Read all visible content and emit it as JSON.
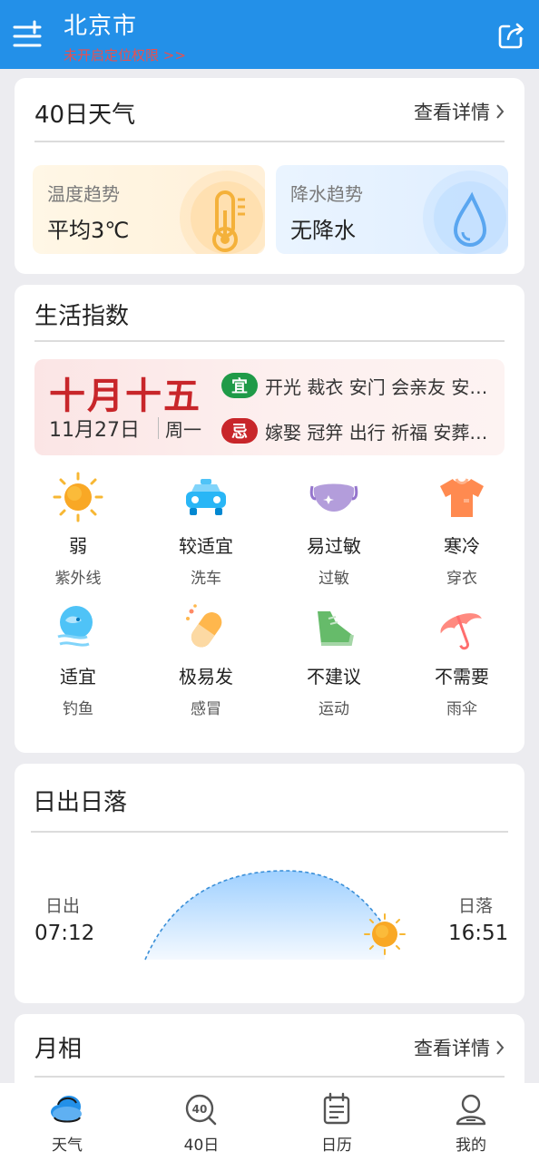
{
  "header": {
    "city": "北京市",
    "location_warning": "未开启定位权限 >>",
    "menu_icon": "add-city-menu-icon",
    "share_icon": "share-icon"
  },
  "forty_day": {
    "title": "40日天气",
    "more": "查看详情",
    "temperature": {
      "label": "温度趋势",
      "value": "平均3℃",
      "icon": "thermometer-icon"
    },
    "precipitation": {
      "label": "降水趋势",
      "value": "无降水",
      "icon": "raindrop-icon"
    }
  },
  "life_index": {
    "title": "生活指数",
    "almanac": {
      "lunar_date": "十月十五",
      "solar_date": "11月27日",
      "weekday": "周一",
      "yi_badge": "宜",
      "yi_text": "开光 裁衣 安门 会亲友 安…",
      "ji_badge": "忌",
      "ji_text": "嫁娶 冠笄 出行 祈福 安葬…"
    },
    "items": [
      {
        "level": "弱",
        "name": "紫外线",
        "icon": "sun-icon"
      },
      {
        "level": "较适宜",
        "name": "洗车",
        "icon": "car-icon"
      },
      {
        "level": "易过敏",
        "name": "过敏",
        "icon": "mask-icon"
      },
      {
        "level": "寒冷",
        "name": "穿衣",
        "icon": "tshirt-icon"
      },
      {
        "level": "适宜",
        "name": "钓鱼",
        "icon": "fish-icon"
      },
      {
        "level": "极易发",
        "name": "感冒",
        "icon": "pill-icon"
      },
      {
        "level": "不建议",
        "name": "运动",
        "icon": "sneaker-icon"
      },
      {
        "level": "不需要",
        "name": "雨伞",
        "icon": "umbrella-icon"
      }
    ]
  },
  "sun": {
    "title": "日出日落",
    "sunrise_label": "日出",
    "sunrise_time": "07:12",
    "sunset_label": "日落",
    "sunset_time": "16:51"
  },
  "moon": {
    "title": "月相",
    "more": "查看详情"
  },
  "tabbar": {
    "tabs": [
      {
        "label": "天气",
        "icon": "cloud-weather-icon",
        "active": true
      },
      {
        "label": "40日",
        "icon": "forty-day-search-icon",
        "active": false
      },
      {
        "label": "日历",
        "icon": "calendar-icon",
        "active": false
      },
      {
        "label": "我的",
        "icon": "user-icon",
        "active": false
      }
    ]
  },
  "colors": {
    "header_blue": "#2390e8",
    "lunar_red": "#c8262a",
    "yi_green": "#1f9a48",
    "ji_red": "#c8262a"
  }
}
